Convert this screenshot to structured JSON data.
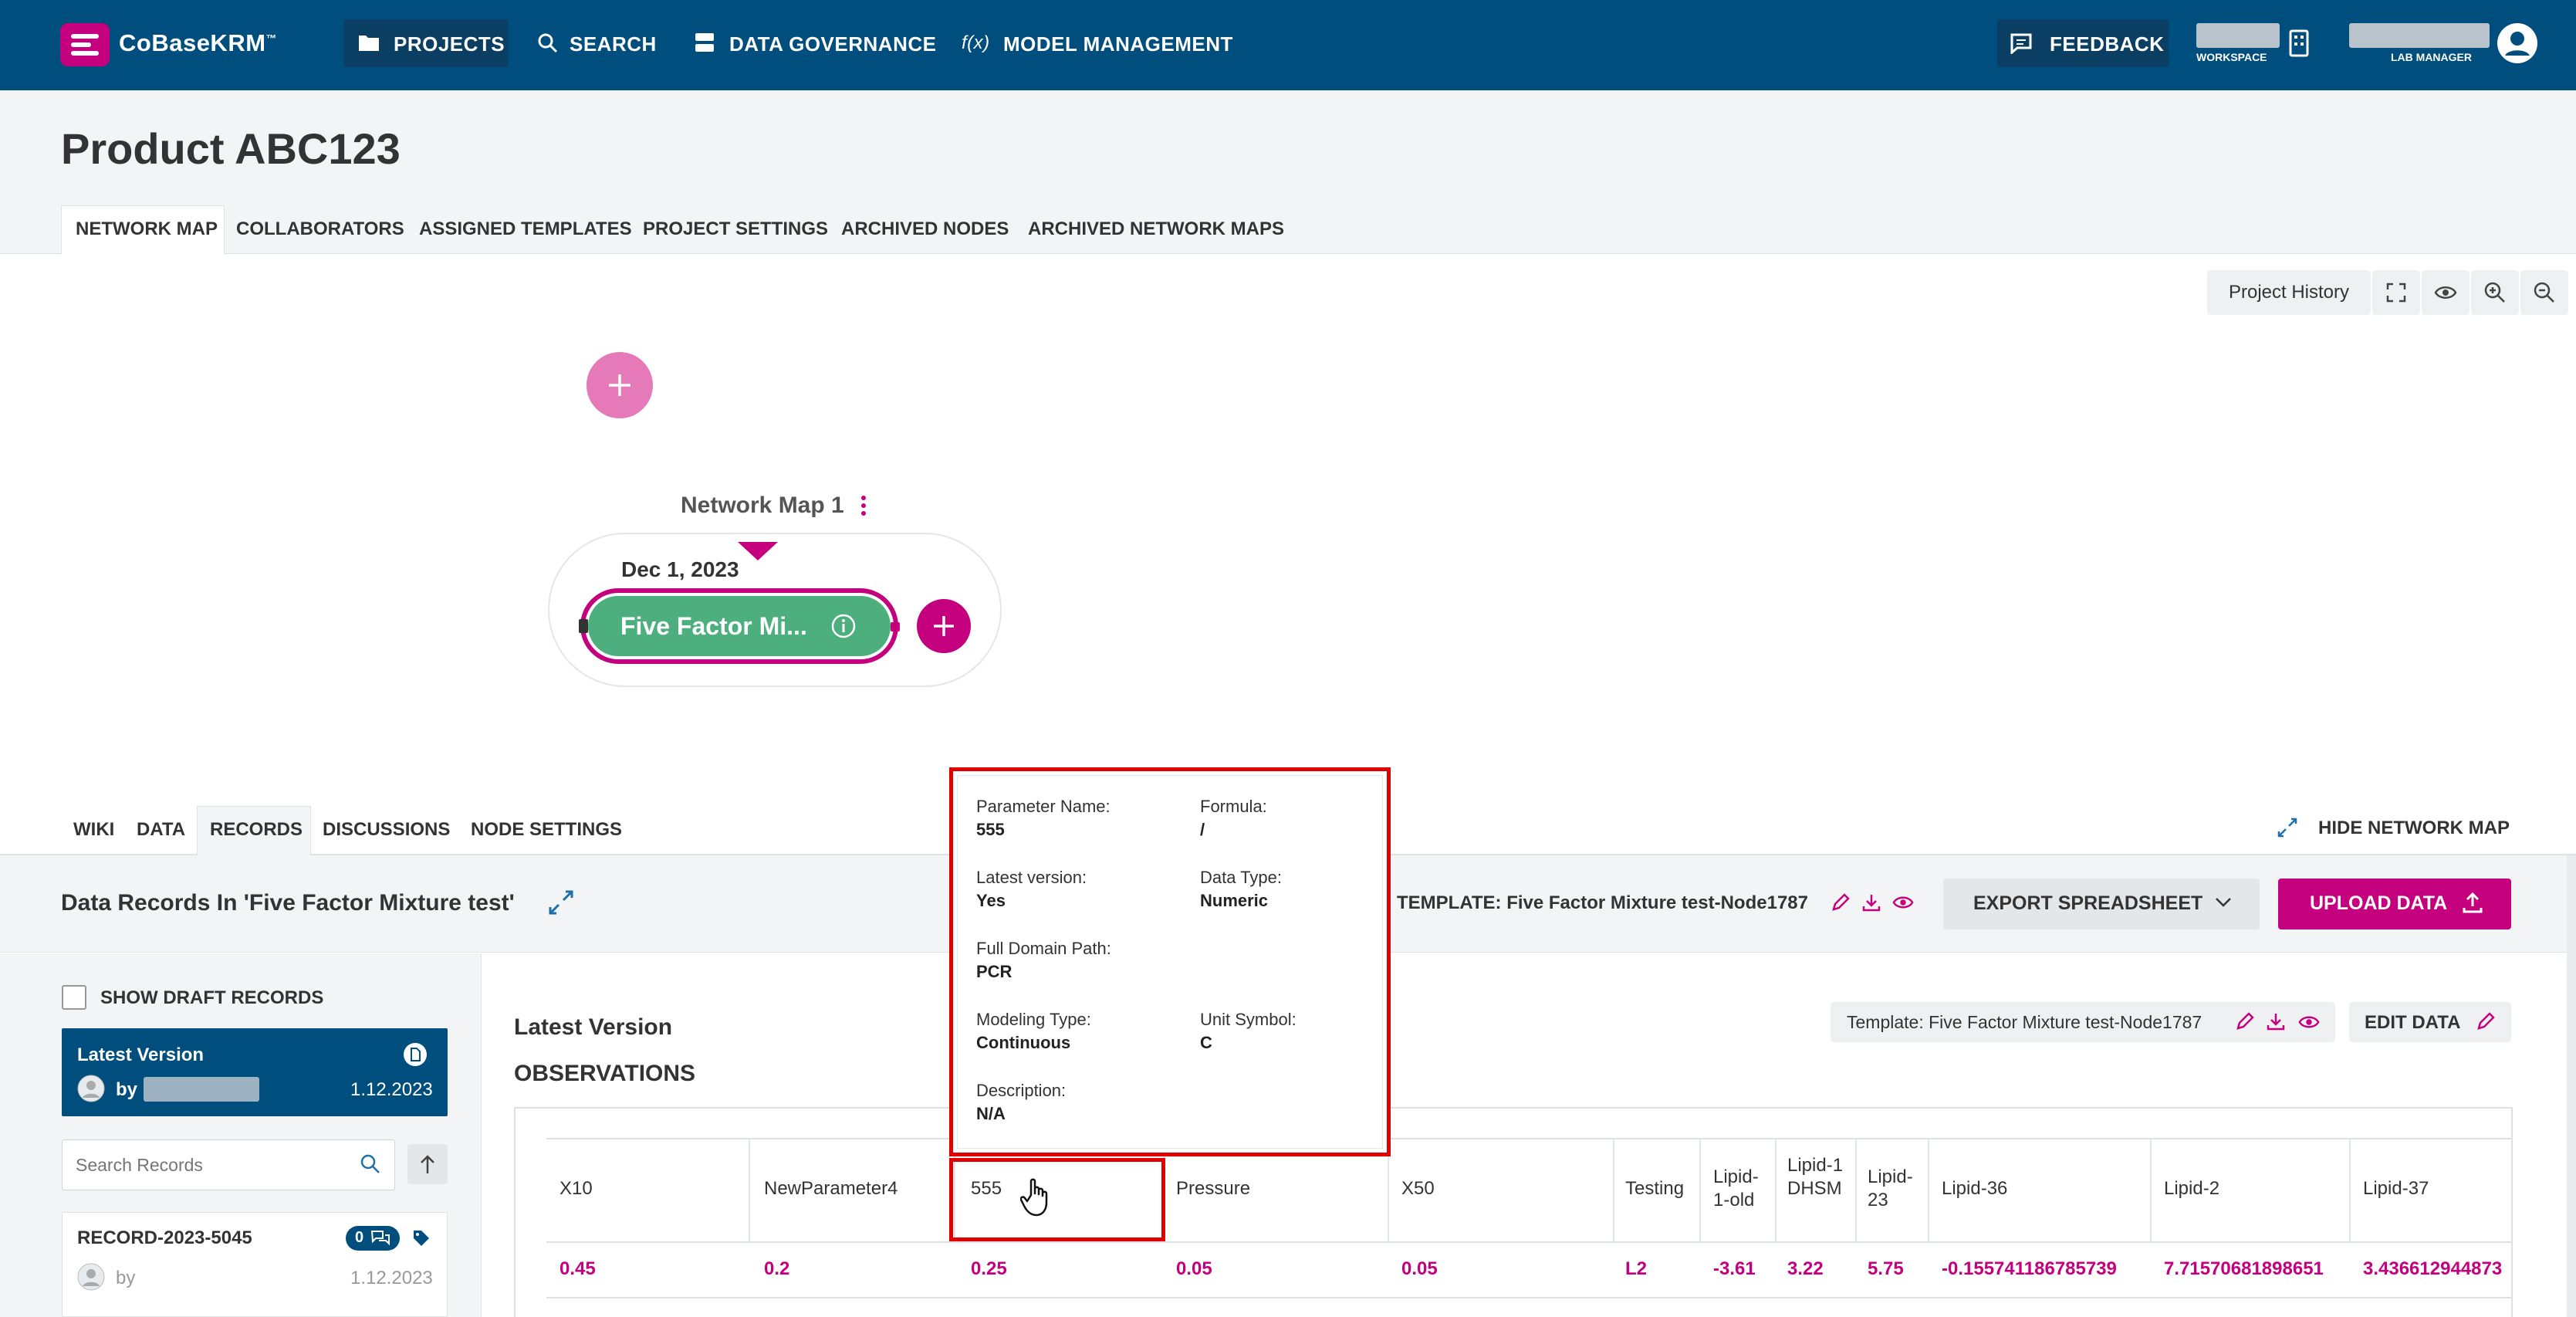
{
  "header": {
    "brand": "CoBaseKRM",
    "brand_tm": "™",
    "nav": [
      {
        "label": "PROJECTS",
        "icon": "folder-icon"
      },
      {
        "label": "SEARCH",
        "icon": "search-icon"
      },
      {
        "label": "DATA GOVERNANCE",
        "icon": "database-icon"
      },
      {
        "label": "MODEL MANAGEMENT",
        "icon": "function-icon",
        "icon_text": "f(x)"
      }
    ],
    "feedback_label": "FEEDBACK",
    "workspace_label": "WORKSPACE",
    "role_label": "LAB MANAGER"
  },
  "page": {
    "title": "Product ABC123",
    "tabs": [
      "NETWORK MAP",
      "COLLABORATORS",
      "ASSIGNED TEMPLATES",
      "PROJECT SETTINGS",
      "ARCHIVED NODES",
      "ARCHIVED NETWORK MAPS"
    ],
    "active_tab": "NETWORK MAP"
  },
  "map": {
    "toolbar_history": "Project History",
    "name": "Network Map 1",
    "date": "Dec 1, 2023",
    "node_label": "Five Factor Mi..."
  },
  "node": {
    "tabs": [
      "WIKI",
      "DATA",
      "RECORDS",
      "DISCUSSIONS",
      "NODE SETTINGS"
    ],
    "active_tab": "RECORDS",
    "hide_map": "HIDE NETWORK MAP",
    "records_title": "Data Records In 'Five Factor Mixture test'",
    "template_header": "TEMPLATE: Five Factor Mixture test-Node1787",
    "export_label": "EXPORT SPREADSHEET",
    "upload_label": "UPLOAD DATA"
  },
  "sidebar": {
    "draft_label": "SHOW DRAFT RECORDS",
    "latest": {
      "title": "Latest Version",
      "by": "by",
      "date": "1.12.2023"
    },
    "search_placeholder": "Search Records",
    "record": {
      "name": "RECORD-2023-5045",
      "count": "0",
      "by": "by",
      "date": "1.12.2023"
    }
  },
  "main": {
    "version_title": "Latest Version",
    "observations_title": "OBSERVATIONS",
    "template_chip": "Template: Five Factor Mixture test-Node1787",
    "edit_label": "EDIT DATA"
  },
  "table": {
    "headers": [
      "X10",
      "NewParameter4",
      "555",
      "Pressure",
      "X50",
      "Testing",
      "Lipid-1-old",
      "Lipid-1 DHSM",
      "Lipid-23",
      "Lipid-36",
      "Lipid-2",
      "Lipid-37"
    ],
    "row": [
      "0.45",
      "0.2",
      "0.25",
      "0.05",
      "0.05",
      "L2",
      "-3.61",
      "3.22",
      "5.75",
      "-0.155741186785739",
      "7.71570681898651",
      "3.436612944873"
    ]
  },
  "tooltip": {
    "param_name_label": "Parameter Name:",
    "param_name": "555",
    "formula_label": "Formula:",
    "formula": "/",
    "latest_label": "Latest version:",
    "latest": "Yes",
    "dtype_label": "Data Type:",
    "dtype": "Numeric",
    "domain_label": "Full Domain Path:",
    "domain": "PCR",
    "modeling_label": "Modeling Type:",
    "modeling": "Continuous",
    "unit_label": "Unit Symbol:",
    "unit": "C",
    "desc_label": "Description:",
    "desc": "N/A"
  },
  "colors": {
    "navbar": "#004e7d",
    "accent": "#c5007f",
    "node_green": "#4caf7d",
    "highlight": "#e00000"
  }
}
